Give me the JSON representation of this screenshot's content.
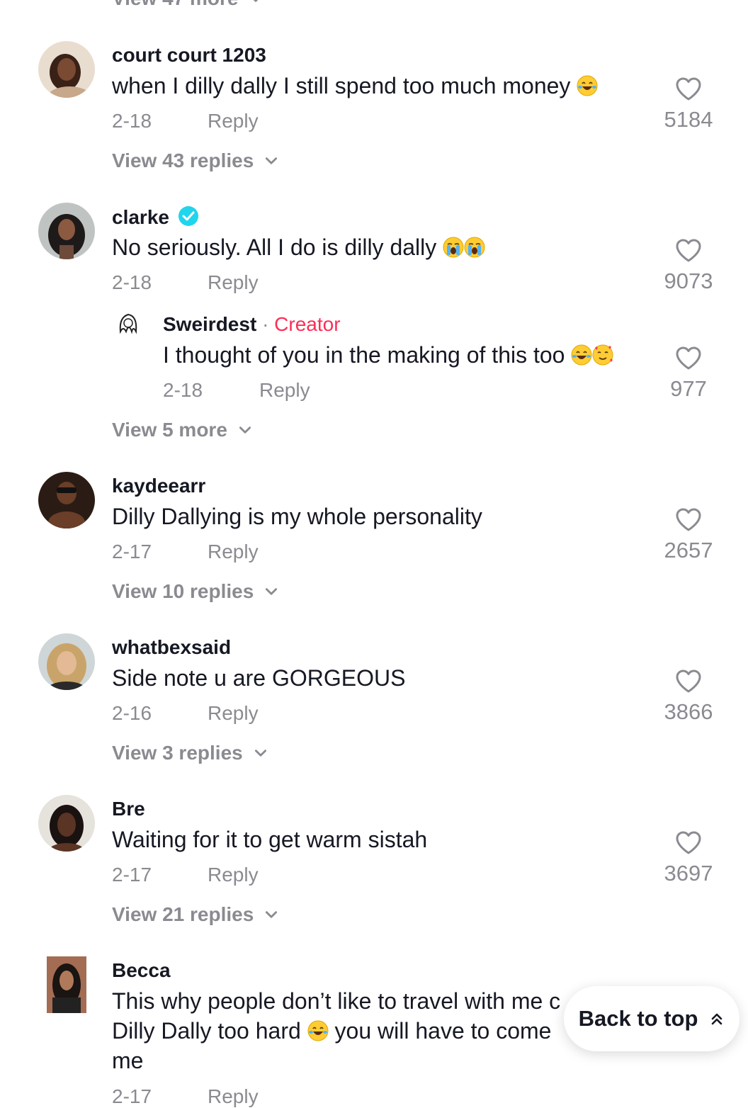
{
  "top_view_more": {
    "label": "View 47 more"
  },
  "comments": [
    {
      "username": "court court 1203",
      "text": "when I dilly dally I still spend too much money",
      "emoji": [
        "rolling-on-floor-laughing"
      ],
      "date": "2-18",
      "reply_label": "Reply",
      "likes": "5184",
      "view_label": "View 43 replies"
    },
    {
      "username": "clarke",
      "verified": true,
      "text": "No seriously. All I do is dilly dally",
      "emoji": [
        "loudly-crying",
        "loudly-crying"
      ],
      "date": "2-18",
      "reply_label": "Reply",
      "likes": "9073",
      "subreply": {
        "username": "Sweirdest",
        "separator": "·",
        "badge": "Creator",
        "text": "I thought of you in the making of this too",
        "emoji": [
          "tears-of-joy",
          "smiling-with-hearts"
        ],
        "date": "2-18",
        "reply_label": "Reply",
        "likes": "977"
      },
      "view_label": "View 5 more"
    },
    {
      "username": "kaydeearr",
      "text": "Dilly Dallying is my whole personality",
      "date": "2-17",
      "reply_label": "Reply",
      "likes": "2657",
      "view_label": "View 10 replies"
    },
    {
      "username": "whatbexsaid",
      "text": "Side note u are GORGEOUS",
      "date": "2-16",
      "reply_label": "Reply",
      "likes": "3866",
      "view_label": "View 3 replies"
    },
    {
      "username": "Bre",
      "text": "Waiting for it to get warm sistah",
      "date": "2-17",
      "reply_label": "Reply",
      "likes": "3697",
      "view_label": "View 21 replies"
    },
    {
      "username": "Becca",
      "text_line1": "This why people don’t like to travel with me c",
      "text_line2_a": "Dilly Dally too hard",
      "text_line2_b": "you will have to come",
      "text_line3": "me",
      "emoji": [
        "tears-of-joy"
      ],
      "date": "2-17",
      "reply_label": "Reply"
    }
  ],
  "back_to_top": {
    "label": "Back to top",
    "icon": "double-chevron-up-icon"
  },
  "colors": {
    "creator": "#fe2c55",
    "muted": "#8a8b91",
    "text": "#161823",
    "verified": "#20d5ec"
  }
}
